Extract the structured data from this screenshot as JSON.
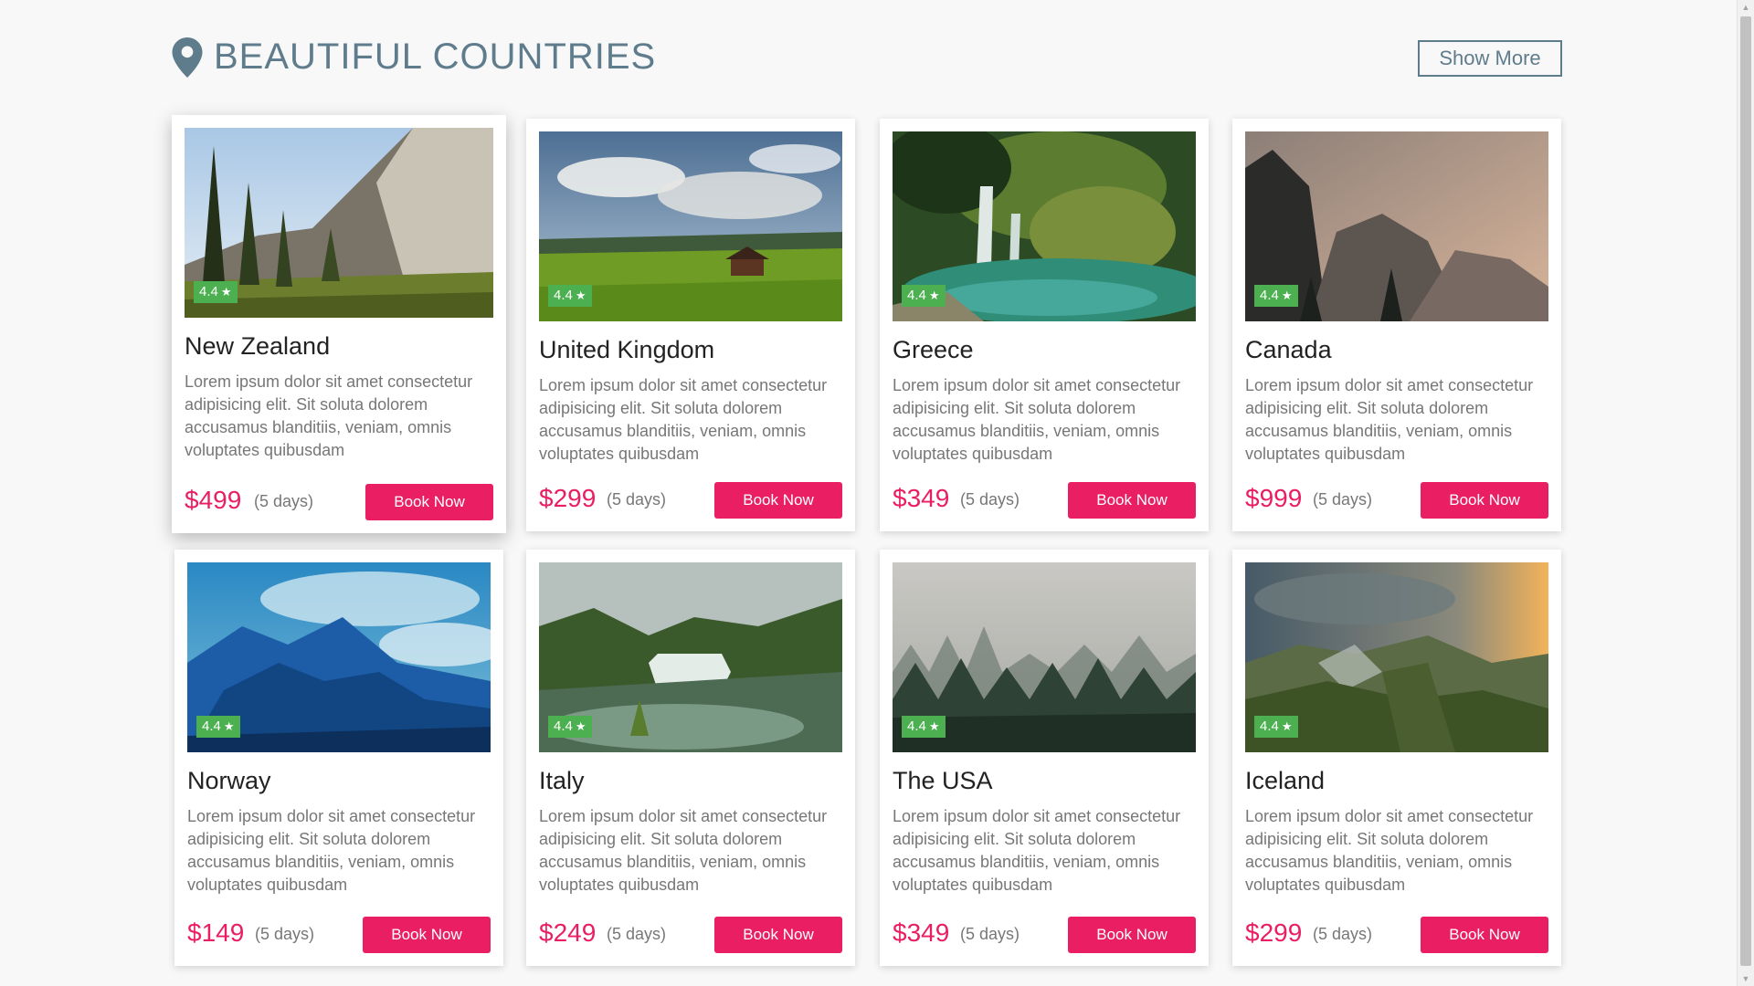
{
  "header": {
    "title": "BEAUTIFUL COUNTRIES",
    "title_icon": "map-pin-icon",
    "show_more_label": "Show More"
  },
  "colors": {
    "heading": "#5f7c8d",
    "accent": "#e91e63",
    "rating": "#4caf50",
    "text_muted": "#777777",
    "background": "#f8f8f8"
  },
  "cards": [
    {
      "name": "New Zealand",
      "rating": "4.4",
      "description": "Lorem ipsum dolor sit amet consectetur adipisicing elit. Sit soluta dolorem accusamus blanditiis, veniam, omnis voluptates quibusdam",
      "price": "$499",
      "duration": "(5 days)",
      "button_label": "Book Now",
      "image_theme": "forest-cliff"
    },
    {
      "name": "United Kingdom",
      "rating": "4.4",
      "description": "Lorem ipsum dolor sit amet consectetur adipisicing elit. Sit soluta dolorem accusamus blanditiis, veniam, omnis voluptates quibusdam",
      "price": "$299",
      "duration": "(5 days)",
      "button_label": "Book Now",
      "image_theme": "green-valley"
    },
    {
      "name": "Greece",
      "rating": "4.4",
      "description": "Lorem ipsum dolor sit amet consectetur adipisicing elit. Sit soluta dolorem accusamus blanditiis, veniam, omnis voluptates quibusdam",
      "price": "$349",
      "duration": "(5 days)",
      "button_label": "Book Now",
      "image_theme": "waterfall-pool"
    },
    {
      "name": "Canada",
      "rating": "4.4",
      "description": "Lorem ipsum dolor sit amet consectetur adipisicing elit. Sit soluta dolorem accusamus blanditiis, veniam, omnis voluptates quibusdam",
      "price": "$999",
      "duration": "(5 days)",
      "button_label": "Book Now",
      "image_theme": "misty-canyon"
    },
    {
      "name": "Norway",
      "rating": "4.4",
      "description": "Lorem ipsum dolor sit amet consectetur adipisicing elit. Sit soluta dolorem accusamus blanditiis, veniam, omnis voluptates quibusdam",
      "price": "$149",
      "duration": "(5 days)",
      "button_label": "Book Now",
      "image_theme": "blue-mountains"
    },
    {
      "name": "Italy",
      "rating": "4.4",
      "description": "Lorem ipsum dolor sit amet consectetur adipisicing elit. Sit soluta dolorem accusamus blanditiis, veniam, omnis voluptates quibusdam",
      "price": "$249",
      "duration": "(5 days)",
      "button_label": "Book Now",
      "image_theme": "river-falls"
    },
    {
      "name": "The USA",
      "rating": "4.4",
      "description": "Lorem ipsum dolor sit amet consectetur adipisicing elit. Sit soluta dolorem accusamus blanditiis, veniam, omnis voluptates quibusdam",
      "price": "$349",
      "duration": "(5 days)",
      "button_label": "Book Now",
      "image_theme": "foggy-forest"
    },
    {
      "name": "Iceland",
      "rating": "4.4",
      "description": "Lorem ipsum dolor sit amet consectetur adipisicing elit. Sit soluta dolorem accusamus blanditiis, veniam, omnis voluptates quibusdam",
      "price": "$299",
      "duration": "(5 days)",
      "button_label": "Book Now",
      "image_theme": "sunset-highlands"
    }
  ]
}
